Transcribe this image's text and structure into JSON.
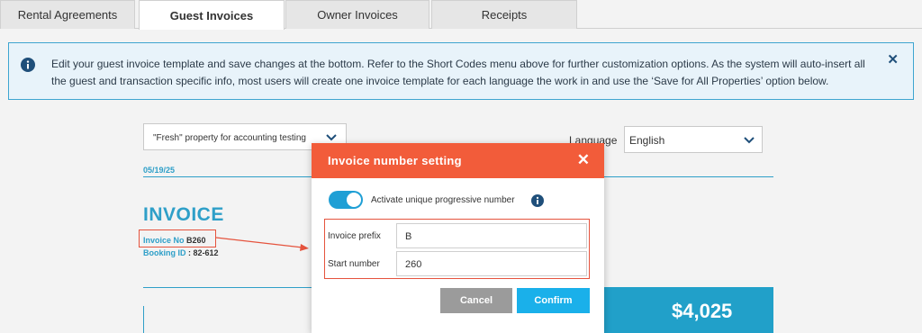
{
  "tabs": [
    {
      "label": "Rental Agreements"
    },
    {
      "label": "Guest Invoices"
    },
    {
      "label": "Owner Invoices"
    },
    {
      "label": "Receipts"
    }
  ],
  "banner": {
    "text": "Edit your guest invoice template and save changes at the bottom. Refer to the Short Codes menu above for further customization options. As the system will auto-insert all the guest and transaction specific info, most users will create one invoice template for each language the work in and use the ‘Save for All Properties’ option below.",
    "close_glyph": "✕"
  },
  "invoice": {
    "property": "\"Fresh\" property for accounting testing",
    "language_label": "Language",
    "language_value": "English",
    "date": "05/19/25",
    "title": "INVOICE",
    "invoice_no_label": "Invoice No",
    "invoice_no_value": "B260",
    "booking_label": "Booking ID",
    "booking_value": ": 82-612",
    "total": "$4,025"
  },
  "modal": {
    "title": "Invoice number setting",
    "close_glyph": "✕",
    "toggle_label": "Activate unique progressive number",
    "toggle_on": true,
    "prefix_label": "Invoice prefix",
    "prefix_value": "B",
    "start_label": "Start number",
    "start_value": "260",
    "cancel_label": "Cancel",
    "confirm_label": "Confirm"
  },
  "colors": {
    "accent": "#2e9fc8",
    "modal_header": "#f25c3a",
    "highlight": "#e5533d",
    "confirm": "#1ab0ea",
    "cancel": "#9b9b9b"
  },
  "icons": [
    "info-icon",
    "close-icon",
    "chevron-down-icon",
    "help-icon",
    "toggle-switch",
    "arrow-annotation"
  ]
}
